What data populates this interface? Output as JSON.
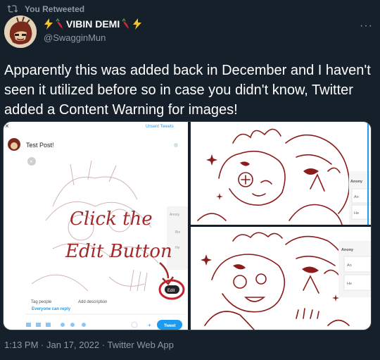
{
  "retweet": {
    "label": "You Retweeted"
  },
  "author": {
    "name": "VIBIN DEMI",
    "handle": "@SwagginMun"
  },
  "more_label": "···",
  "tweet": {
    "text": "Apparently this was added back in December and I haven't seen it utilized before so in case you didn't know, Twitter added a Content Warning for images!"
  },
  "media": {
    "left": {
      "unsent_tweets": "Unsent Tweets",
      "close": "×",
      "post_text": "Test Post!",
      "annotation_line1": "Click the",
      "annotation_line2": "Edit Button",
      "edit_label": "Edit",
      "side_label1": "Anony",
      "side_label2": "Bio",
      "side_label3": "He",
      "tag_people": "Tag people",
      "add_description": "Add description",
      "reply_setting": "Everyone can reply",
      "tweet_button": "Tweet",
      "plus": "+"
    },
    "top_right": {
      "card_title": "Anony",
      "card_l1": "An",
      "card_l2": "He"
    },
    "bottom_right": {
      "card_title": "Anony",
      "card_l1": "An",
      "card_l2": "He"
    }
  },
  "meta": {
    "timestamp": "1:13 PM · Jan 17, 2022 · Twitter Web App"
  },
  "colors": {
    "background": "#15202b",
    "accent": "#1d9bf0",
    "annotation": "#a02a2a",
    "muted": "#8b98a5"
  }
}
